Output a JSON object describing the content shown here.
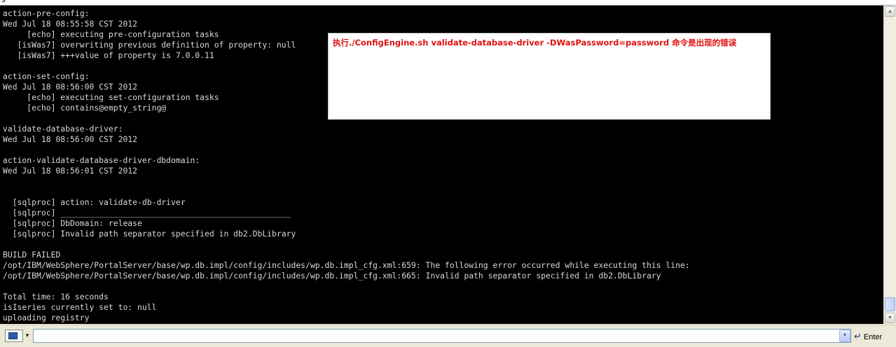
{
  "menu": {
    "item": "s"
  },
  "terminal": {
    "lines": [
      "action-pre-config:",
      "Wed Jul 18 08:55:58 CST 2012",
      "     [echo] executing pre-configuration tasks",
      "   [isWas7] overwriting previous definition of property: null",
      "   [isWas7] +++value of property is 7.0.0.11",
      "",
      "action-set-config:",
      "Wed Jul 18 08:56:00 CST 2012",
      "     [echo] executing set-configuration tasks",
      "     [echo] contains@empty_string@",
      "",
      "validate-database-driver:",
      "Wed Jul 18 08:56:00 CST 2012",
      "",
      "action-validate-database-driver-dbdomain:",
      "Wed Jul 18 08:56:01 CST 2012",
      "",
      "",
      "  [sqlproc] action: validate-db-driver",
      "  [sqlproc] ________________________________________________",
      "  [sqlproc] DbDomain: release",
      "  [sqlproc] Invalid path separator specified in db2.DbLibrary",
      "",
      "BUILD FAILED",
      "/opt/IBM/WebSphere/PortalServer/base/wp.db.impl/config/includes/wp.db.impl_cfg.xml:659: The following error occurred while executing this line:",
      "/opt/IBM/WebSphere/PortalServer/base/wp.db.impl/config/includes/wp.db.impl_cfg.xml:665: Invalid path separator specified in db2.DbLibrary",
      "",
      "Total time: 16 seconds",
      "isIseries currently set to: null",
      "uploading registry"
    ]
  },
  "annotation": {
    "text": "执行./ConfigEngine.sh validate-database-driver -DWasPassword=password  命令是出现的错误"
  },
  "command_bar": {
    "input_value": "",
    "enter_label": "Enter"
  },
  "colors": {
    "terminal_bg": "#000000",
    "terminal_fg": "#d8d8d8",
    "annotation_text": "#e01010"
  }
}
